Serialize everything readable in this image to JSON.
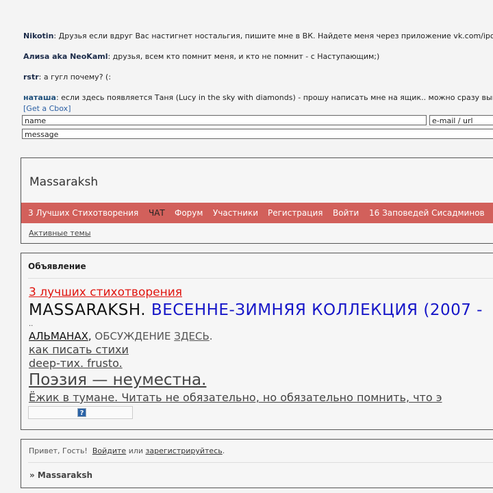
{
  "cbox": {
    "messages": [
      {
        "author": "Nikotin",
        "text": ": Друзья если вдруг Вас настигнет ностальгия, пишите мне в ВК. Найдете меня через приложение vk.com/ipod"
      },
      {
        "author": "Алиsа aka NeoKaml",
        "text": ": друзья, всем кто помнит меня, и кто не помнит - с Наступающим;)"
      },
      {
        "author": "rstr",
        "text": ": а гугл почему? (:"
      },
      {
        "author": "наташа",
        "text": ": если здесь появляется Таня (Lucy in the sky with diamonds) - прошу написать мне на ящик.. можно сразу вып"
      }
    ],
    "get_cbox_label": "[Get a Cbox]",
    "name_placeholder": "name",
    "email_placeholder": "e-mail / url",
    "message_placeholder": "message"
  },
  "header": {
    "site_title": "Massaraksh",
    "nav": [
      "3 Лучших Стихотворения",
      "ЧАТ",
      "Форум",
      "Участники",
      "Регистрация",
      "Войти",
      "16 Заповедей Сисадминов"
    ],
    "active_topics": "Активные темы"
  },
  "announcement": {
    "heading": "Объявление",
    "line1": "3 лучших стихотворения",
    "line2_a": "MASSARAKSH. ",
    "line2_b": "ВЕСЕННЕ-ЗИМНЯЯ КОЛЛЕКЦИЯ (2007 -",
    "line3": "..",
    "line4_a": "АЛЬМАНАХ",
    "line4_b": ", ",
    "line4_c": "ОБСУЖДЕНИЕ ",
    "line4_d": "ЗДЕСЬ",
    "line4_e": ".",
    "line5": "как писать стихи",
    "line6": "deep-тих. frusto.",
    "line7": "Поэзия — неуместна.",
    "line8": "Ёжик в тумане. Читать не обязательно, но обязательно помнить, что э",
    "help_icon": "question-icon"
  },
  "footer": {
    "greet_a": "Привет, Гость!  ",
    "login": "Войдите",
    "greet_b": " или ",
    "register": "зарегистрируйтесь",
    "greet_c": ".",
    "breadcrumb": "» Massaraksh"
  }
}
